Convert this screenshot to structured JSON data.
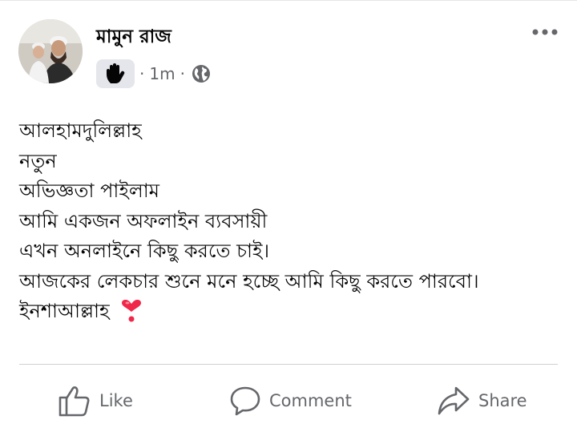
{
  "post": {
    "author": "মামুন রাজ",
    "time": "1m",
    "separator": "·",
    "privacy_icon": "globe-icon",
    "badge_icon": "waving-hand-icon",
    "lines": [
      "আলহামদুলিল্লাহ",
      "নতুন",
      "অভিজ্ঞতা পাইলাম",
      "আমি একজন অফলাইন ব্যবসায়ী",
      "এখন অনলাইনে কিছু করতে চাই।",
      "আজকের লেকচার শুনে মনে হচ্ছে আমি কিছু করতে পারবো।",
      "ইনশাআল্লাহ"
    ],
    "emoji": "heart-exclamation-icon"
  },
  "actions": {
    "like": "Like",
    "comment": "Comment",
    "share": "Share"
  },
  "colors": {
    "text": "#050505",
    "secondary": "#65676b",
    "divider": "#ced0d4",
    "heart": "#f02849"
  }
}
